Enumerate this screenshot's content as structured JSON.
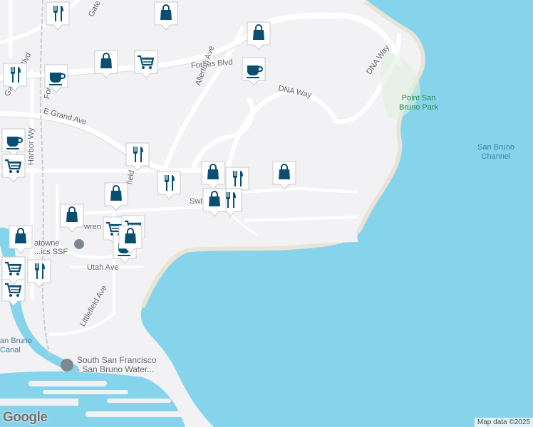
{
  "map": {
    "water_color": "#86d4ec",
    "land_color": "#f2f2f4",
    "pin_color": "#0a4f72"
  },
  "labels": {
    "forbes_blvd": "Forbes Blvd",
    "allerton_ave": "Allerton Ave",
    "dna_way_1": "DNA Way",
    "dna_way_2": "DNA Way",
    "e_grand_ave": "E Grand Ave",
    "harbor_wy": "Harbor Wy",
    "gateway_blvd": "Gateway Blvd",
    "gate_top": "Gate",
    "forbes_left": "Forbes",
    "swift_partial": "Swif",
    "lawrence_partial": "wren",
    "field_partial": "field",
    "utah_ave": "Utah Ave",
    "littlefield_ave": "Littlefield Ave",
    "point_san_bruno_park": "Point San\nBruno Park",
    "san_bruno_channel": "San Bruno\nChannel",
    "canal_partial": "an Bruno\nCanal",
    "genentech_partial": "atowne\n...ics SSF",
    "water_plant": "South San Francisco\n- San Bruno Water..."
  },
  "pins": [
    {
      "icon": "restaurant-icon"
    },
    {
      "icon": "shopping-bag-icon"
    },
    {
      "icon": "shopping-bag-icon"
    },
    {
      "icon": "shopping-bag-icon"
    },
    {
      "icon": "shopping-cart-icon"
    },
    {
      "icon": "coffee-icon"
    },
    {
      "icon": "coffee-icon"
    },
    {
      "icon": "restaurant-icon"
    },
    {
      "icon": "coffee-icon"
    },
    {
      "icon": "shopping-cart-icon"
    },
    {
      "icon": "restaurant-icon"
    },
    {
      "icon": "restaurant-icon"
    },
    {
      "icon": "shopping-bag-icon"
    },
    {
      "icon": "restaurant-icon"
    },
    {
      "icon": "shopping-bag-icon"
    },
    {
      "icon": "restaurant-icon"
    },
    {
      "icon": "shopping-bag-icon"
    },
    {
      "icon": "shopping-bag-icon"
    },
    {
      "icon": "shopping-bag-icon"
    },
    {
      "icon": "shopping-bag-icon"
    },
    {
      "icon": "shopping-cart-icon"
    },
    {
      "icon": "shopping-cart-icon"
    },
    {
      "icon": "coffee-icon"
    },
    {
      "icon": "shopping-bag-icon"
    },
    {
      "icon": "restaurant-icon"
    },
    {
      "icon": "shopping-cart-icon"
    },
    {
      "icon": "shopping-cart-icon"
    }
  ],
  "footer": {
    "logo_text": "Google",
    "attribution": "Map data ©2025"
  }
}
